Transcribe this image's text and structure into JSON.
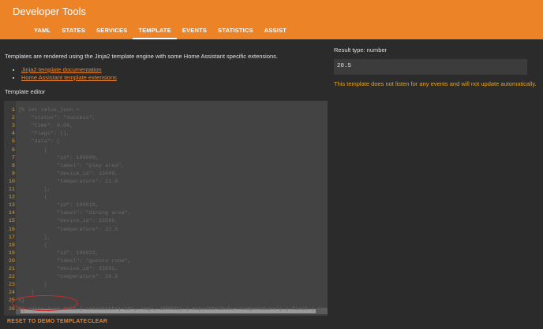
{
  "header": {
    "title": "Developer Tools",
    "tabs": [
      {
        "label": "YAML",
        "active": false
      },
      {
        "label": "STATES",
        "active": false
      },
      {
        "label": "SERVICES",
        "active": false
      },
      {
        "label": "TEMPLATE",
        "active": true
      },
      {
        "label": "EVENTS",
        "active": false
      },
      {
        "label": "STATISTICS",
        "active": false
      },
      {
        "label": "ASSIST",
        "active": false
      }
    ]
  },
  "intro": {
    "text": "Templates are rendered using the Jinja2 template engine with some Home Assistant specific extensions.",
    "links": [
      "Jinja2 template documentation",
      "Home Assistant template extensions"
    ]
  },
  "editor": {
    "label": "Template editor",
    "line_numbers": [
      "1",
      "2",
      "3",
      "4",
      "5",
      "6",
      "7",
      "8",
      "9",
      "10",
      "11",
      "12",
      "13",
      "14",
      "15",
      "16",
      "17",
      "18",
      "19",
      "20",
      "21",
      "22",
      "23",
      "24",
      "25",
      "26"
    ],
    "lines": [
      "{% set value_json =",
      "    \"status\": \"success\",",
      "    \"time\": 0.04,",
      "    \"flags\": [],",
      "    \"data\": [",
      "        {",
      "            \"id\": 100009,",
      "            \"label\": \"play area\",",
      "            \"device_id\": 13489,",
      "            \"temperature\": 21.0",
      "        },",
      "        {",
      "            \"id\": 100019,",
      "            \"label\": \"dining area\",",
      "            \"device_id\": 13589,",
      "            \"temperature\": 22.5",
      "        },",
      "        {",
      "            \"id\": 100021,",
      "            \"label\": \"guests room\",",
      "            \"device_id\": 13591,",
      "            \"temperature\": 20.5",
      "        }",
      "    ]",
      "%}",
      "{{ value_json.data | selectattr('id', 'eq', 100021) | map(attribute='temperature') | first | round"
    ]
  },
  "buttons": {
    "reset": "RESET TO DEMO TEMPLATE",
    "clear": "CLEAR"
  },
  "result": {
    "type_label": "Result type: number",
    "value": "20.5",
    "listen_note": "This template does not listen for any events and will not update automatically."
  },
  "colors": {
    "accent": "#ec8326",
    "background": "#2b2b2b",
    "editor_bg": "#434343",
    "warning": "#e8a31a",
    "annotation": "#d42a2a"
  }
}
